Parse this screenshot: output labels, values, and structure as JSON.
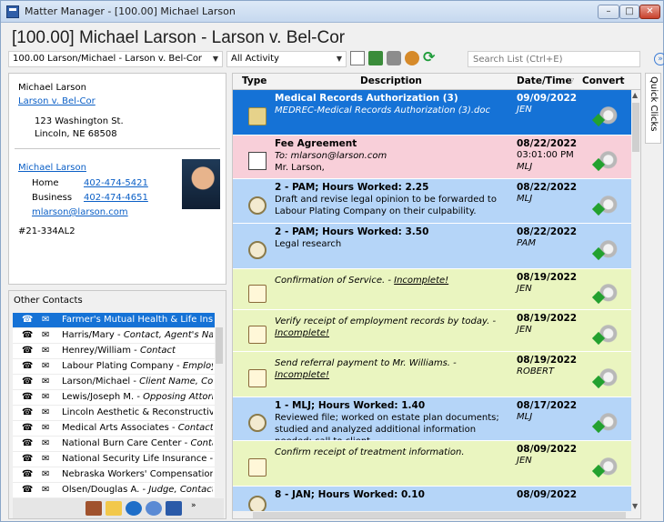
{
  "window": {
    "title": "Matter Manager - [100.00] Michael Larson",
    "minimize": "–",
    "maximize": "□",
    "close": "✕"
  },
  "heading": "[100.00] Michael Larson - Larson v. Bel-Cor",
  "toolbar": {
    "matter_value": "100.00 Larson/Michael - Larson v. Bel-Cor",
    "activity_value": "All Activity",
    "search_placeholder": "Search List (Ctrl+E)",
    "dropdown_arrow": "▼",
    "expand_icon": "»"
  },
  "contact_card": {
    "client_name": "Michael Larson",
    "case_link": "Larson v. Bel-Cor",
    "address_line1": "123 Washington St.",
    "address_line2": "Lincoln, NE  68508",
    "contact_link": "Michael Larson",
    "home_label": "Home",
    "home_phone": "402-474-5421",
    "business_label": "Business",
    "business_phone": "402-474-4651",
    "email": "mlarson@larson.com",
    "id_number": "#21-334AL2"
  },
  "other_contacts": {
    "title": "Other Contacts",
    "phone_glyph": "☎",
    "mail_glyph": "✉",
    "items": [
      {
        "name": "Farmer's Mutual Health & Life Ins",
        "role": "",
        "selected": true
      },
      {
        "name": "Harris/Mary - ",
        "role": "Contact, Agent's Nar",
        "selected": false
      },
      {
        "name": "Henrey/William - ",
        "role": "Contact",
        "selected": false
      },
      {
        "name": "Labour Plating Company - ",
        "role": "Employe",
        "selected": false
      },
      {
        "name": "Larson/Michael - ",
        "role": "Client Name, Con",
        "selected": false
      },
      {
        "name": "Lewis/Joseph M. - ",
        "role": "Opposing Attorr",
        "selected": false
      },
      {
        "name": "Lincoln Aesthetic & Reconstructive",
        "role": "",
        "selected": false
      },
      {
        "name": "Medical Arts Associates - ",
        "role": "Contact,",
        "selected": false
      },
      {
        "name": "National Burn Care Center - ",
        "role": "Conta",
        "selected": false
      },
      {
        "name": "National Security Life Insurance - ",
        "role": "E",
        "selected": false
      },
      {
        "name": "Nebraska Workers' Compensation",
        "role": "",
        "selected": false
      },
      {
        "name": "Olsen/Douglas A. - ",
        "role": "Judge, Contact",
        "selected": false
      }
    ],
    "more_glyph": "»"
  },
  "grid": {
    "headers": {
      "type": "Type",
      "description": "Description",
      "datetime": "Date/Time",
      "convert": "Convert",
      "sort_glyph": "▽"
    },
    "rows": [
      {
        "icon": "document-icon",
        "title": "Medical Records Authorization (3)",
        "sub": "MEDREC-Medical Records Authorization (3).doc",
        "date": "09/09/2022",
        "time": "",
        "who": "JEN"
      },
      {
        "icon": "envelope-icon",
        "title": "Fee Agreement",
        "sub": "To:  mlarson@larson.com\nMr. Larson,",
        "date": "08/22/2022",
        "time": "03:01:00 PM",
        "who": "MLJ"
      },
      {
        "icon": "stopwatch-icon",
        "title": "2 - PAM;  Hours Worked:  2.25",
        "sub": "Draft and revise legal opinion to be forwarded to Labour Plating Company on their culpability.",
        "date": "08/22/2022",
        "time": "",
        "who": "MLJ"
      },
      {
        "icon": "stopwatch-icon",
        "title": "2 - PAM;  Hours Worked:  3.50",
        "sub": "Legal research",
        "date": "08/22/2022",
        "time": "",
        "who": "PAM"
      },
      {
        "icon": "task-icon",
        "title": "",
        "sub": "Confirmation of Service. - ",
        "sub_link": "Incomplete!",
        "date": "08/19/2022",
        "time": "",
        "who": "JEN"
      },
      {
        "icon": "task-icon",
        "title": "",
        "sub": "Verify receipt of employment records by today. - ",
        "sub_link": "Incomplete!",
        "date": "08/19/2022",
        "time": "",
        "who": "JEN"
      },
      {
        "icon": "task-icon",
        "title": "",
        "sub": "Send referral payment to Mr. Williams. - ",
        "sub_link": "Incomplete!",
        "date": "08/19/2022",
        "time": "",
        "who": "ROBERT"
      },
      {
        "icon": "stopwatch-icon",
        "title": "1 - MLJ;  Hours Worked:  1.40",
        "sub": "Reviewed file; worked on estate plan documents; studied and analyzed additional information needed; call to client",
        "date": "08/17/2022",
        "time": "",
        "who": "MLJ"
      },
      {
        "icon": "task-icon",
        "title": "",
        "sub": "Confirm receipt of treatment information.",
        "date": "08/09/2022",
        "time": "",
        "who": "JEN"
      },
      {
        "icon": "stopwatch-icon",
        "title": "8 - JAN;  Hours Worked:  0.10",
        "sub": "",
        "date": "08/09/2022",
        "time": "",
        "who": ""
      }
    ]
  },
  "quick_clicks_label": "Quick Clicks",
  "scroll": {
    "up": "▲",
    "down": "▼",
    "left": "◀",
    "right": "▶"
  }
}
